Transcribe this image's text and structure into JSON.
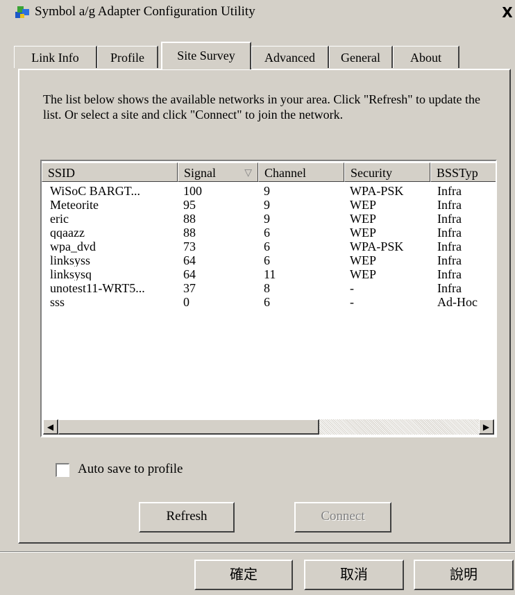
{
  "window": {
    "title": "Symbol a/g Adapter Configuration Utility",
    "close_glyph": "X"
  },
  "tabs": [
    {
      "label": "Link Info",
      "active": false
    },
    {
      "label": "Profile",
      "active": false
    },
    {
      "label": "Site Survey",
      "active": true
    },
    {
      "label": "Advanced",
      "active": false
    },
    {
      "label": "General",
      "active": false
    },
    {
      "label": "About",
      "active": false
    }
  ],
  "description": "The list below shows the available networks in your area. Click \"Refresh\" to update the list. Or select a site and click \"Connect\" to join the network.",
  "list": {
    "columns": [
      "SSID",
      "Signal",
      "Channel",
      "Security",
      "BSSTyp"
    ],
    "sorted_by": "Signal",
    "sort_icon": "sort-desc-icon",
    "rows": [
      [
        "WiSoC BARGT...",
        "100",
        "9",
        "WPA-PSK",
        "Infra"
      ],
      [
        "Meteorite",
        "95",
        "9",
        "WEP",
        "Infra"
      ],
      [
        "eric",
        "88",
        "9",
        "WEP",
        "Infra"
      ],
      [
        "qqaazz",
        "88",
        "6",
        "WEP",
        "Infra"
      ],
      [
        "wpa_dvd",
        "73",
        "6",
        "WPA-PSK",
        "Infra"
      ],
      [
        "linksyss",
        "64",
        "6",
        "WEP",
        "Infra"
      ],
      [
        "linksysq",
        "64",
        "11",
        "WEP",
        "Infra"
      ],
      [
        "unotest11-WRT5...",
        "37",
        "8",
        "-",
        "Infra"
      ],
      [
        "sss",
        "0",
        "6",
        "-",
        "Ad-Hoc"
      ]
    ]
  },
  "auto_save": {
    "label": "Auto save to profile",
    "checked": false
  },
  "buttons": {
    "refresh": "Refresh",
    "connect": "Connect",
    "ok": "確定",
    "cancel": "取消",
    "help": "說明"
  },
  "colors": {
    "face": "#d4d0c8",
    "shadow": "#404040",
    "disabled": "#808080"
  }
}
